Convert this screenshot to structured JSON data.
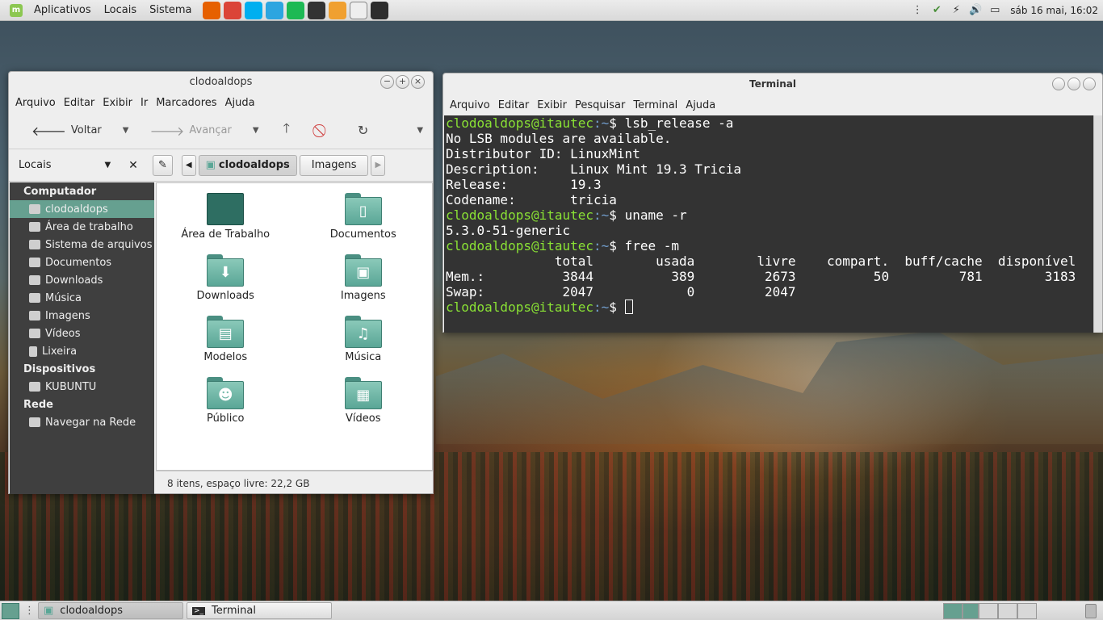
{
  "top_panel": {
    "menus": [
      "Aplicativos",
      "Locais",
      "Sistema"
    ],
    "launchers": [
      {
        "icon": "firefox-icon",
        "color": "#e66000"
      },
      {
        "icon": "chrome-icon",
        "color": "#db4437"
      },
      {
        "icon": "skype-icon",
        "color": "#00aff0"
      },
      {
        "icon": "telegram-icon",
        "color": "#2ca5e0"
      },
      {
        "icon": "spotify-icon",
        "color": "#1db954"
      },
      {
        "icon": "media-player-icon",
        "color": "#333333"
      },
      {
        "icon": "video-editor-icon",
        "color": "#f0a030"
      },
      {
        "icon": "text-editor-icon",
        "color": "#eeeeee"
      },
      {
        "icon": "terminal-launcher-icon",
        "color": "#2d2d2d"
      }
    ],
    "clock": "sáb 16 mai, 16:02"
  },
  "file_manager": {
    "title": "clodoaldops",
    "menu": [
      "Arquivo",
      "Editar",
      "Exibir",
      "Ir",
      "Marcadores",
      "Ajuda"
    ],
    "toolbar": {
      "back": "Voltar",
      "forward": "Avançar"
    },
    "side_combo": "Locais",
    "path": [
      "clodoaldops",
      "Imagens"
    ],
    "sidebar": {
      "computer_header": "Computador",
      "computer_items": [
        "clodoaldops",
        "Área de trabalho",
        "Sistema de arquivos",
        "Documentos",
        "Downloads",
        "Música",
        "Imagens",
        "Vídeos",
        "Lixeira"
      ],
      "devices_header": "Dispositivos",
      "devices_items": [
        "KUBUNTU"
      ],
      "network_header": "Rede",
      "network_items": [
        "Navegar na Rede"
      ]
    },
    "files": [
      "Área de Trabalho",
      "Documentos",
      "Downloads",
      "Imagens",
      "Modelos",
      "Música",
      "Público",
      "Vídeos"
    ],
    "status": "8 itens, espaço livre: 22,2 GB"
  },
  "terminal": {
    "title": "Terminal",
    "menu": [
      "Arquivo",
      "Editar",
      "Exibir",
      "Pesquisar",
      "Terminal",
      "Ajuda"
    ],
    "prompt_user": "clodoaldops@itautec",
    "prompt_path": ":~",
    "prompt_sign": "$ ",
    "commands": [
      "lsb_release -a",
      "uname -r",
      "free -m"
    ],
    "lsb_output": [
      "No LSB modules are available.",
      "Distributor ID: LinuxMint",
      "Description:    Linux Mint 19.3 Tricia",
      "Release:        19.3",
      "Codename:       tricia"
    ],
    "uname_output": "5.3.0-51-generic",
    "free_output": [
      "              total        usada        livre    compart.  buff/cache  disponível",
      "Mem.:          3844          389         2673          50         781        3183",
      "Swap:          2047            0         2047"
    ]
  },
  "taskbar": {
    "tasks": [
      "clodoaldops",
      "Terminal"
    ]
  }
}
